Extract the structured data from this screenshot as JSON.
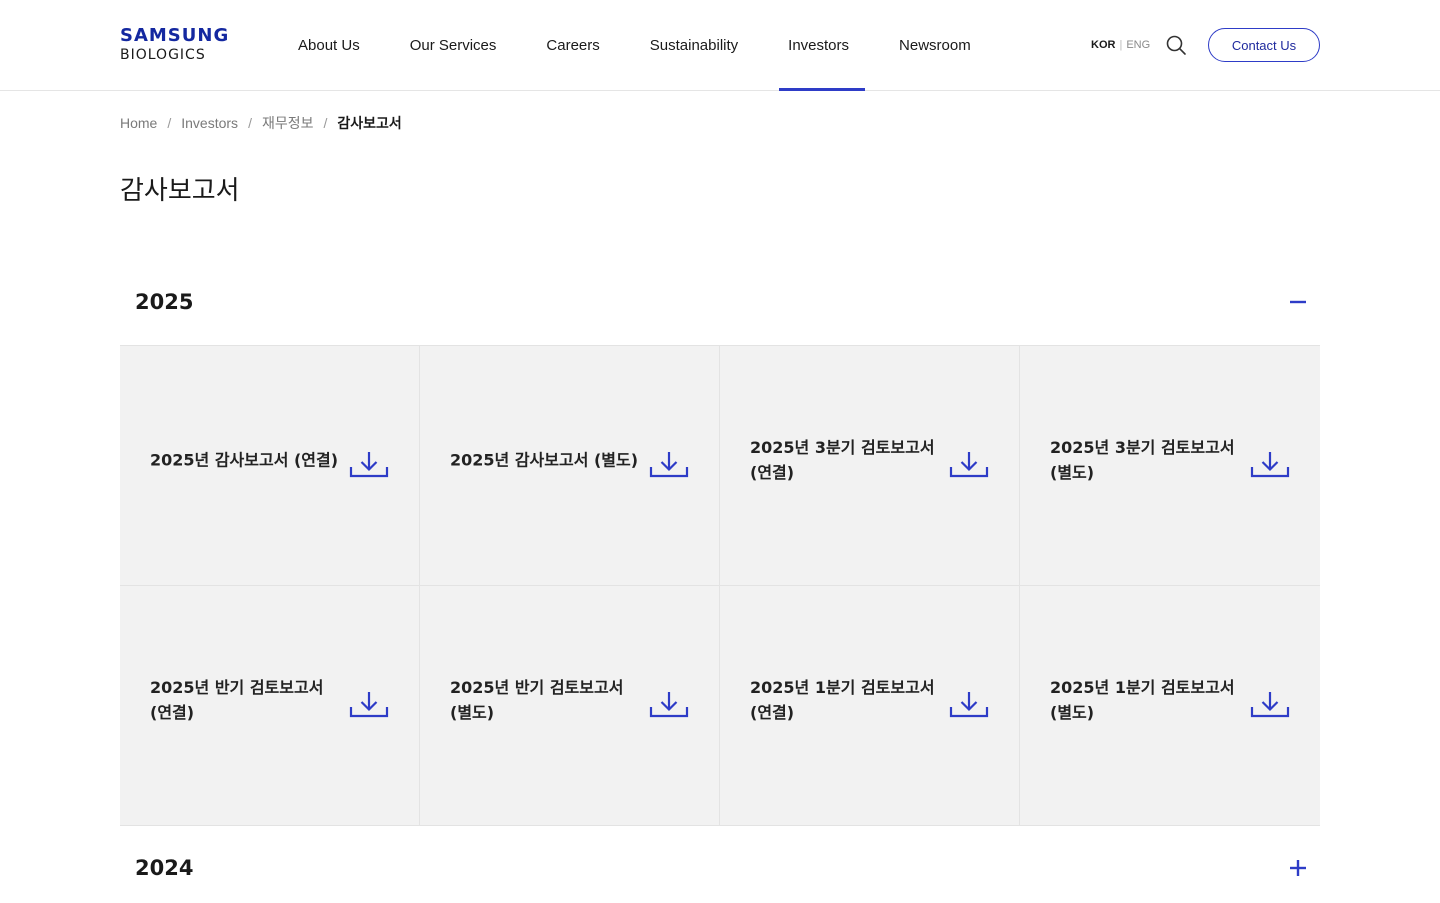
{
  "brand": {
    "name_top": "SAMSUNG",
    "name_bottom": "BIOLOGICS",
    "accent_color": "#2e3cc7"
  },
  "nav": {
    "items": [
      {
        "label": "About Us",
        "active": false
      },
      {
        "label": "Our Services",
        "active": false
      },
      {
        "label": "Careers",
        "active": false
      },
      {
        "label": "Sustainability",
        "active": false
      },
      {
        "label": "Investors",
        "active": true
      },
      {
        "label": "Newsroom",
        "active": false
      }
    ],
    "lang_kor": "KOR",
    "lang_separator": "|",
    "lang_eng": "ENG",
    "search_icon": "search-icon",
    "contact_label": "Contact Us"
  },
  "breadcrumb": {
    "items": [
      "Home",
      "Investors",
      "재무정보"
    ],
    "separator": "/",
    "current": "감사보고서"
  },
  "page": {
    "title": "감사보고서"
  },
  "sections": [
    {
      "year": "2025",
      "expanded": true,
      "toggle_icon": "minus-icon",
      "reports": [
        {
          "title": "2025년 감사보고서 (연결)",
          "icon": "download-icon"
        },
        {
          "title": "2025년 감사보고서 (별도)",
          "icon": "download-icon"
        },
        {
          "title": "2025년 3분기 검토보고서 (연결)",
          "icon": "download-icon"
        },
        {
          "title": "2025년 3분기 검토보고서 (별도)",
          "icon": "download-icon"
        },
        {
          "title": "2025년 반기 검토보고서 (연결)",
          "icon": "download-icon"
        },
        {
          "title": "2025년 반기 검토보고서 (별도)",
          "icon": "download-icon"
        },
        {
          "title": "2025년 1분기 검토보고서 (연결)",
          "icon": "download-icon"
        },
        {
          "title": "2025년 1분기 검토보고서 (별도)",
          "icon": "download-icon"
        }
      ]
    },
    {
      "year": "2024",
      "expanded": false,
      "toggle_icon": "plus-icon",
      "reports": []
    }
  ]
}
